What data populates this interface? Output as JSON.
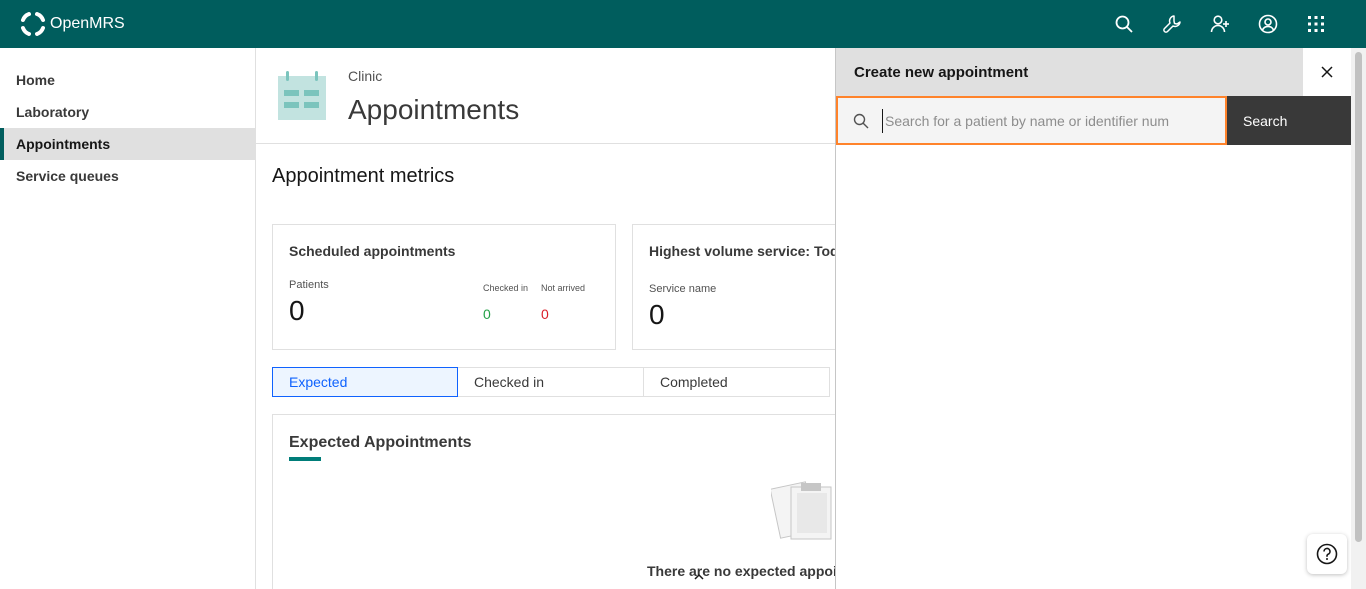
{
  "app": {
    "brand": "OpenMRS"
  },
  "topbar": {
    "color": "#005d5d",
    "icons": [
      "search-icon",
      "wrench-icon",
      "add-user-icon",
      "user-avatar-icon",
      "app-switcher-icon"
    ]
  },
  "sidebar": {
    "items": [
      {
        "label": "Home",
        "active": false
      },
      {
        "label": "Laboratory",
        "active": false
      },
      {
        "label": "Appointments",
        "active": true
      },
      {
        "label": "Service queues",
        "active": false
      }
    ]
  },
  "page": {
    "location": "Clinic",
    "title": "Appointments"
  },
  "metrics": {
    "title": "Appointment metrics",
    "scheduled": {
      "title": "Scheduled appointments",
      "patients_label": "Patients",
      "patients_value": "0",
      "checked_in_label": "Checked in",
      "checked_in_value": "0",
      "not_arrived_label": "Not arrived",
      "not_arrived_value": "0"
    },
    "highest_volume": {
      "title": "Highest volume service: Tod",
      "service_name_label": "Service name",
      "value": "0"
    }
  },
  "tabs": [
    {
      "label": "Expected",
      "active": true
    },
    {
      "label": "Checked in",
      "active": false
    },
    {
      "label": "Completed",
      "active": false
    }
  ],
  "expected": {
    "title": "Expected Appointments",
    "empty_text": "There are no expected appoi"
  },
  "overlay": {
    "title": "Create new appointment",
    "search_placeholder": "Search for a patient by name or identifier num",
    "search_button": "Search"
  },
  "colors": {
    "accent": "#005d5d",
    "focus_border": "#ff832b",
    "active_tab": "#0f62fe",
    "checked_in": "#24a148",
    "not_arrived": "#da1e28"
  }
}
